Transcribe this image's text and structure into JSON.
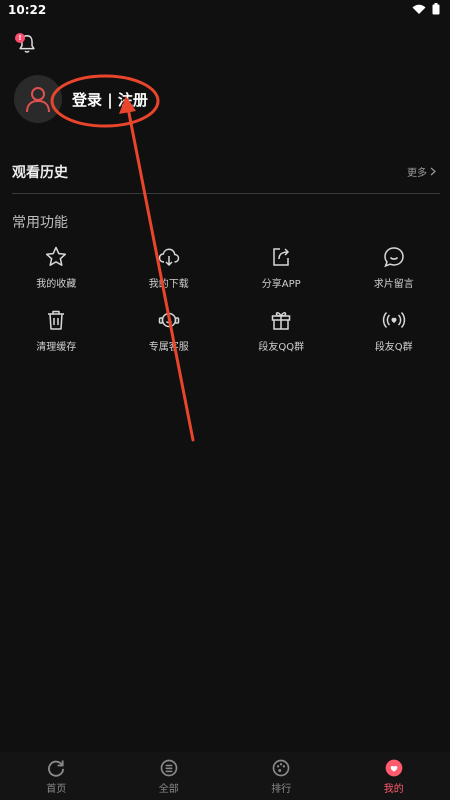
{
  "status": {
    "time": "10:22"
  },
  "profile": {
    "login_label": "登录 | 注册"
  },
  "history": {
    "title": "观看历史",
    "more_label": "更多"
  },
  "functions": {
    "title": "常用功能",
    "items": [
      {
        "label": "我的收藏",
        "icon": "star-icon"
      },
      {
        "label": "我的下载",
        "icon": "cloud-download-icon"
      },
      {
        "label": "分享APP",
        "icon": "share-icon"
      },
      {
        "label": "求片留言",
        "icon": "chat-bubble-icon"
      },
      {
        "label": "清理缓存",
        "icon": "trash-icon"
      },
      {
        "label": "专属客服",
        "icon": "headset-icon"
      },
      {
        "label": "段友QQ群",
        "icon": "gift-icon"
      },
      {
        "label": "段友Q群",
        "icon": "broadcast-icon"
      }
    ]
  },
  "tabbar": {
    "tabs": [
      {
        "label": "首页",
        "icon": "refresh-home-icon",
        "active": false
      },
      {
        "label": "全部",
        "icon": "list-box-icon",
        "active": false
      },
      {
        "label": "排行",
        "icon": "palette-icon",
        "active": false
      },
      {
        "label": "我的",
        "icon": "profile-heart-icon",
        "active": true
      }
    ]
  },
  "colors": {
    "accent": "#ff5a6e",
    "annotation": "#e8452c",
    "background": "#101010"
  }
}
